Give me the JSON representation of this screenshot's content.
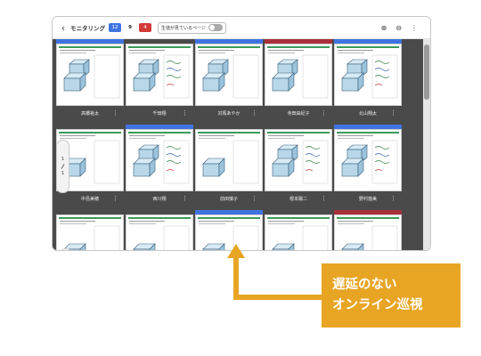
{
  "header": {
    "title": "モニタリング",
    "back_icon": "chevron-left-icon",
    "badges": [
      {
        "value": "12",
        "kind": "blue"
      },
      {
        "value": "9",
        "kind": "plain"
      },
      {
        "value": "4",
        "kind": "red"
      }
    ],
    "toggle_label": "生徒が見ているページ",
    "toggle_on": false,
    "icons": [
      "zoom-in-icon",
      "zoom-out-icon",
      "more-vert-icon"
    ]
  },
  "colors": {
    "blue": "#3f74e0",
    "red": "#a8303a",
    "none": "#4a4a4a",
    "accent": "#e8a524"
  },
  "students": [
    {
      "name": "高橋裕太",
      "status": "blue",
      "work": "cubes"
    },
    {
      "name": "千田翔",
      "status": "none",
      "work": "cubes-notes"
    },
    {
      "name": "対馬あやか",
      "status": "blue",
      "work": "cubes"
    },
    {
      "name": "寺田由紀子",
      "status": "red",
      "work": "cubes"
    },
    {
      "name": "北山翔太",
      "status": "blue",
      "work": "cubes-notes"
    },
    {
      "name": "中島美穂",
      "status": "none",
      "work": "cube"
    },
    {
      "name": "西川翔",
      "status": "blue",
      "work": "cubes-notes"
    },
    {
      "name": "前田慎子",
      "status": "none",
      "work": "cube"
    },
    {
      "name": "根本陽二",
      "status": "none",
      "work": "cubes-notes"
    },
    {
      "name": "野村悠美",
      "status": "blue",
      "work": "cubes-notes"
    },
    {
      "name": "",
      "status": "none",
      "work": "cube"
    },
    {
      "name": "",
      "status": "none",
      "work": "cube"
    },
    {
      "name": "",
      "status": "blue",
      "work": "cube"
    },
    {
      "name": "",
      "status": "none",
      "work": "cube"
    },
    {
      "name": "",
      "status": "red",
      "work": "cube"
    }
  ],
  "pager": {
    "current": "1",
    "total": "1"
  },
  "callout": {
    "line1": "遅延のない",
    "line2": "オンライン巡視"
  }
}
